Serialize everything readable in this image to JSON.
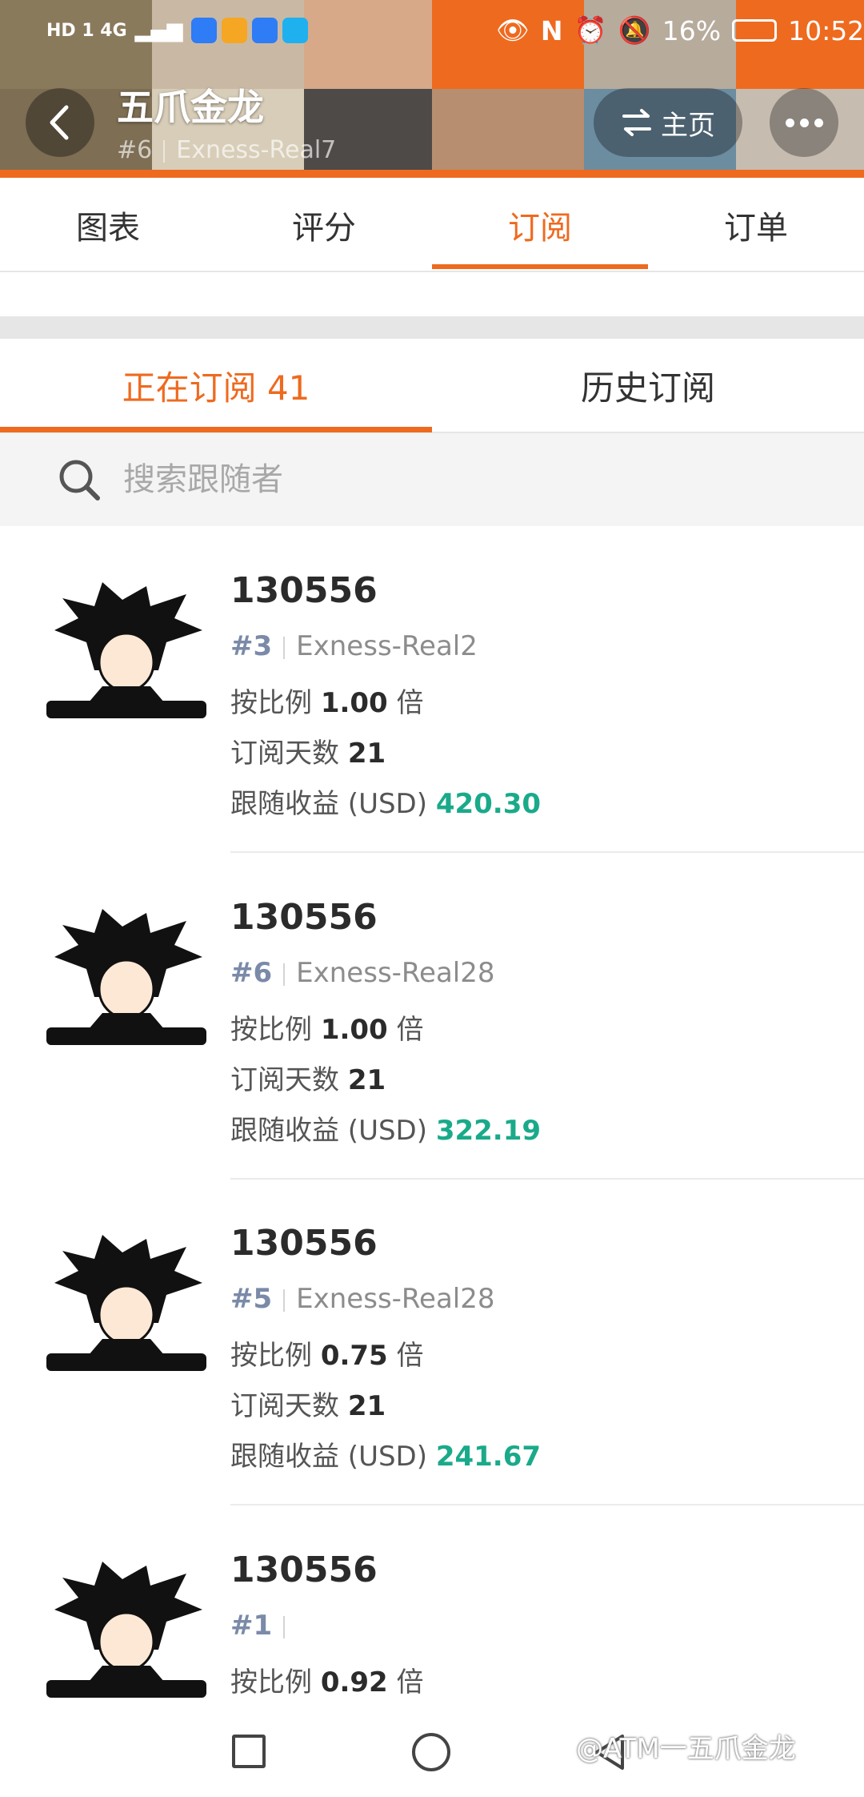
{
  "status_bar": {
    "network_left": "HD 1 4G",
    "battery": "16%",
    "time": "10:52"
  },
  "header": {
    "title": "五爪金龙",
    "rank": "#6",
    "server": "Exness-Real7",
    "home_label": "主页",
    "back_icon": "back-arrow-icon",
    "more_icon": "more-dots-icon",
    "switch_icon": "swap-icon"
  },
  "tabs": [
    "图表",
    "评分",
    "订阅",
    "订单"
  ],
  "active_tab": 2,
  "sub_tabs": [
    "正在订阅 41",
    "历史订阅"
  ],
  "active_sub_tab": 0,
  "search": {
    "placeholder": "搜索跟随者"
  },
  "labels": {
    "ratio_prefix": "按比例",
    "ratio_suffix": "倍",
    "days": "订阅天数",
    "profit": "跟随收益 (USD)"
  },
  "subscribers": [
    {
      "name": "130556",
      "rank": "#3",
      "server": "Exness-Real2",
      "ratio": "1.00",
      "days": "21",
      "profit": "420.30"
    },
    {
      "name": "130556",
      "rank": "#6",
      "server": "Exness-Real28",
      "ratio": "1.00",
      "days": "21",
      "profit": "322.19"
    },
    {
      "name": "130556",
      "rank": "#5",
      "server": "Exness-Real28",
      "ratio": "0.75",
      "days": "21",
      "profit": "241.67"
    },
    {
      "name": "130556",
      "rank": "#1",
      "server": "",
      "ratio": "0.92"
    }
  ],
  "watermark": "@ATM一五爪金龙",
  "colors": {
    "accent": "#ee6a1f",
    "profit": "#1aaa8a",
    "rank": "#7a8aa8"
  }
}
